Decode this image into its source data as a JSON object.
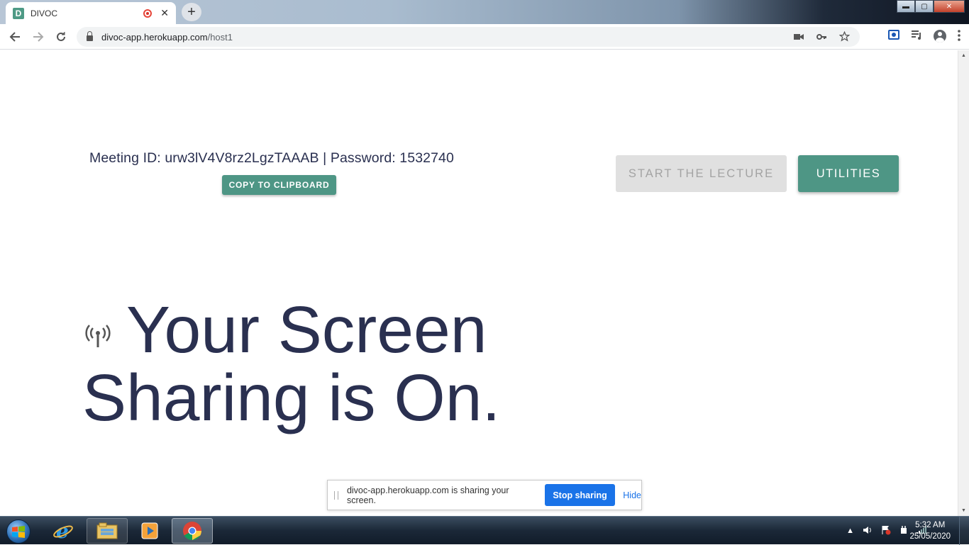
{
  "browser": {
    "tab_title": "DIVOC",
    "favicon_letter": "D",
    "tab_close": "✕",
    "new_tab": "+",
    "url_host": "divoc-app.herokuapp.com",
    "url_path": "/host1",
    "window_buttons": {
      "minimize": "▬",
      "maximize": "▢",
      "close": "✕"
    }
  },
  "page": {
    "meeting_line": "Meeting ID: urw3lV4V8rz2LgzTAAAB | Password: 1532740",
    "copy_button": "COPY TO CLIPBOARD",
    "start_lecture_button": "START THE LECTURE",
    "utilities_button": "UTILITIES",
    "headline_line1": "Your Screen",
    "headline_line2": "Sharing is On."
  },
  "share_bar": {
    "message": "divoc-app.herokuapp.com is sharing your screen.",
    "stop_button": "Stop sharing",
    "hide_link": "Hide"
  },
  "taskbar": {
    "time": "5:32 AM",
    "date": "25/05/2020"
  },
  "colors": {
    "accent": "#4e9685",
    "text_dark": "#2a3050",
    "share_blue": "#1a73e8",
    "disabled_bg": "#e0e0e0"
  }
}
